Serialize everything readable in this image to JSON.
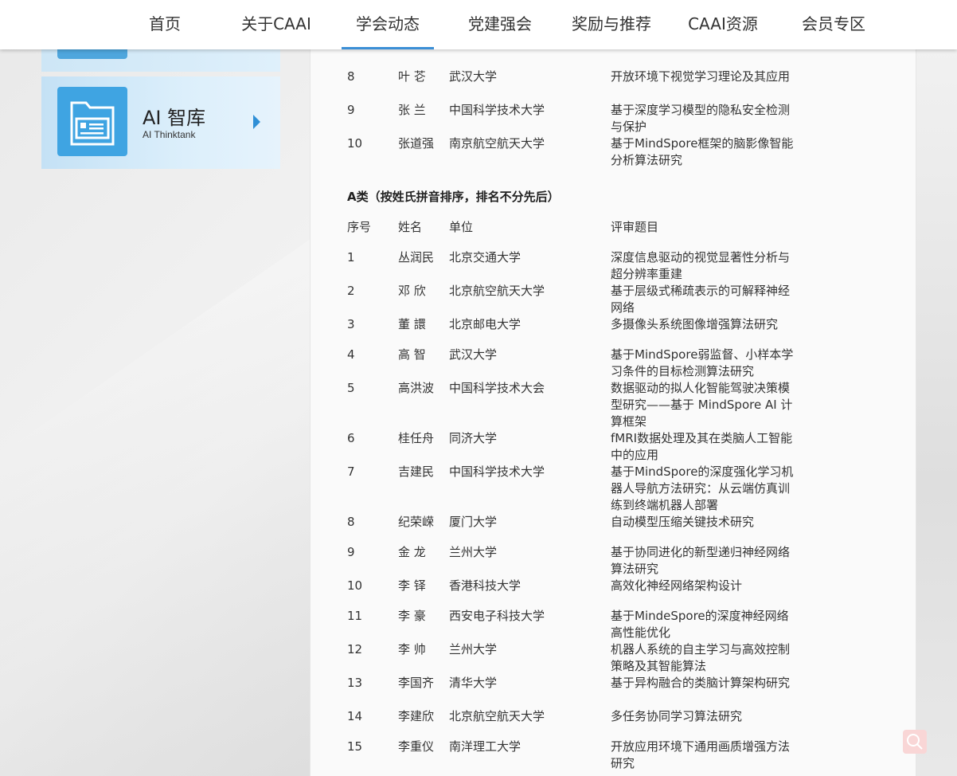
{
  "nav": {
    "items": [
      {
        "label": "首页"
      },
      {
        "label": "关于CAAI"
      },
      {
        "label": "学会动态",
        "active": true
      },
      {
        "label": "党建强会"
      },
      {
        "label": "奖励与推荐"
      },
      {
        "label": "CAAI资源"
      },
      {
        "label": "会员专区"
      }
    ],
    "accent_color": "#3b8fd6"
  },
  "sidebar": {
    "card": {
      "title": "AI 智库",
      "subtitle": "AI Thinktank",
      "icon": "folder-document-icon"
    }
  },
  "prev_list": [
    {
      "no": "8",
      "name": "叶 芲",
      "org": "武汉大学",
      "topic": "开放环境下视觉学习理论及其应用"
    },
    {
      "no": "9",
      "name": "张 兰",
      "org": "中国科学技术大学",
      "topic": "基于深度学习模型的隐私安全检测与保护"
    },
    {
      "no": "10",
      "name": "张道强",
      "org": "南京航空航天大学",
      "topic": "基于MindSpore框架的脑影像智能分析算法研究"
    }
  ],
  "section_a": {
    "title": "A类（按姓氏拼音排序，排名不分先后）",
    "headers": {
      "no": "序号",
      "name": "姓名",
      "org": "单位",
      "topic": "评审题目"
    },
    "rows": [
      {
        "no": "1",
        "name": "丛润民",
        "org": "北京交通大学",
        "topic": "深度信息驱动的视觉显著性分析与超分辨率重建"
      },
      {
        "no": "2",
        "name": "邓 欣",
        "org": "北京航空航天大学",
        "topic": "基于层级式稀疏表示的可解释神经网络"
      },
      {
        "no": "3",
        "name": "董 譞",
        "org": "北京邮电大学",
        "topic": "多摄像头系统图像增强算法研究"
      },
      {
        "no": "4",
        "name": "高 智",
        "org": "武汉大学",
        "topic": "基于MindSpore弱监督、小样本学习条件的目标检测算法研究"
      },
      {
        "no": "5",
        "name": "高洪波",
        "org": "中国科学技术大会",
        "topic": "数据驱动的拟人化智能驾驶决策模型研究——基于 MindSpore AI 计算框架"
      },
      {
        "no": "6",
        "name": "桂任舟",
        "org": "同济大学",
        "topic": "fMRI数据处理及其在类脑人工智能中的应用"
      },
      {
        "no": "7",
        "name": "吉建民",
        "org": "中国科学技术大学",
        "topic": "基于MindSpore的深度强化学习机器人导航方法研究：从云端仿真训练到终端机器人部署"
      },
      {
        "no": "8",
        "name": "纪荣嵘",
        "org": "厦门大学",
        "topic": "自动模型压缩关键技术研究"
      },
      {
        "no": "9",
        "name": "金 龙",
        "org": "兰州大学",
        "topic": "基于协同进化的新型递归神经网络算法研究"
      },
      {
        "no": "10",
        "name": "李 铎",
        "org": "香港科技大学",
        "topic": "高效化神经网络架构设计"
      },
      {
        "no": "11",
        "name": "李 豪",
        "org": "西安电子科技大学",
        "topic": "基于MindeSpore的深度神经网络高性能优化"
      },
      {
        "no": "12",
        "name": "李 帅",
        "org": "兰州大学",
        "topic": "机器人系统的自主学习与高效控制策略及其智能算法"
      },
      {
        "no": "13",
        "name": "李国齐",
        "org": "清华大学",
        "topic": "基于异构融合的类脑计算架构研究"
      },
      {
        "no": "14",
        "name": "李建欣",
        "org": "北京航空航天大学",
        "topic": "多任务协同学习算法研究"
      },
      {
        "no": "15",
        "name": "李重仪",
        "org": "南洋理工大学",
        "topic": "开放应用环境下通用画质增强方法研究"
      }
    ]
  }
}
